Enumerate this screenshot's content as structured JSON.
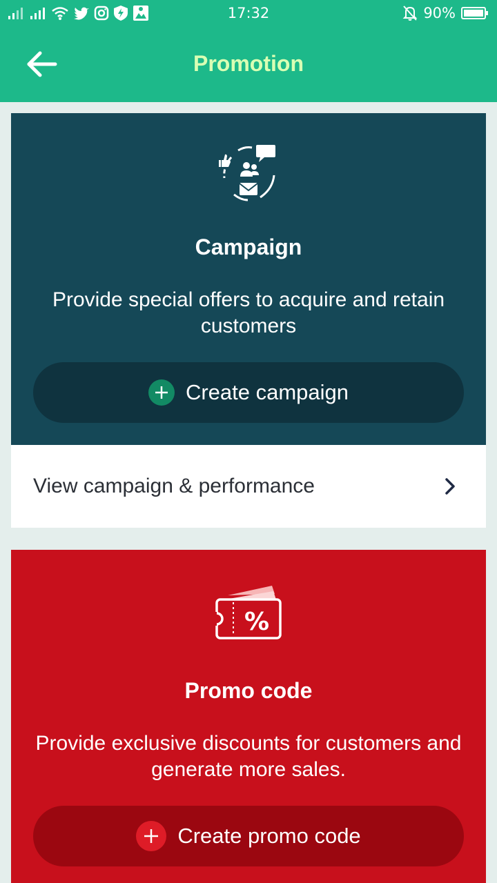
{
  "status_bar": {
    "time": "17:32",
    "battery": "90%",
    "icons": [
      "signal-icon",
      "signal-icon",
      "wifi-icon",
      "twitter-icon",
      "instagram-icon",
      "shield-bolt-icon",
      "image-icon",
      "mute-icon",
      "battery-icon"
    ]
  },
  "app_bar": {
    "title": "Promotion",
    "back_icon": "arrow-left-icon",
    "title_color": "#d9ffb4",
    "background": "#1db98a"
  },
  "campaign": {
    "icon": "campaign-icon",
    "title": "Campaign",
    "description": "Provide special offers to acquire and retain customers",
    "button_label": "Create campaign",
    "background": "#154857"
  },
  "view_campaign": {
    "label": "View campaign & performance",
    "icon": "chevron-right-icon"
  },
  "promo": {
    "icon": "coupon-percent-icon",
    "title": "Promo code",
    "description": "Provide exclusive discounts for customers and generate more sales.",
    "button_label": "Create promo code",
    "background": "#c8101c"
  }
}
